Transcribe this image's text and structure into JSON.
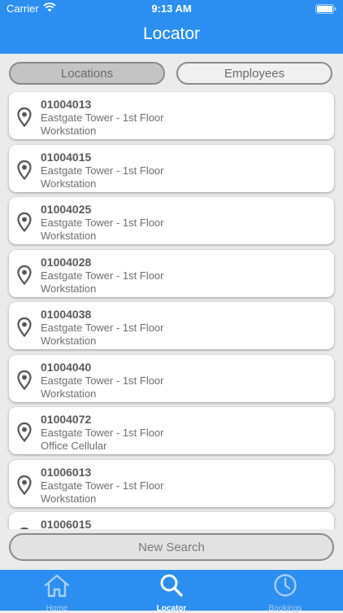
{
  "status_bar": {
    "carrier": "Carrier",
    "time": "9:13 AM"
  },
  "header": {
    "title": "Locator"
  },
  "segments": {
    "locations": "Locations",
    "employees": "Employees",
    "selected": "Locations"
  },
  "locations": [
    {
      "code": "01004013",
      "building": "Eastgate Tower - 1st Floor",
      "type": "Workstation"
    },
    {
      "code": "01004015",
      "building": "Eastgate Tower - 1st Floor",
      "type": "Workstation"
    },
    {
      "code": "01004025",
      "building": "Eastgate Tower - 1st Floor",
      "type": "Workstation"
    },
    {
      "code": "01004028",
      "building": "Eastgate Tower - 1st Floor",
      "type": "Workstation"
    },
    {
      "code": "01004038",
      "building": "Eastgate Tower - 1st Floor",
      "type": "Workstation"
    },
    {
      "code": "01004040",
      "building": "Eastgate Tower - 1st Floor",
      "type": "Workstation"
    },
    {
      "code": "01004072",
      "building": "Eastgate Tower - 1st Floor",
      "type": "Office Cellular"
    },
    {
      "code": "01006013",
      "building": "Eastgate Tower - 1st Floor",
      "type": "Workstation"
    },
    {
      "code": "01006015",
      "building": "",
      "type": ""
    }
  ],
  "new_search_label": "New Search",
  "tabbar": {
    "home": "Home",
    "locator": "Locator",
    "bookings": "Bookings"
  },
  "icons": {
    "wifi": "wifi-icon",
    "battery": "battery-icon",
    "pin": "location-pin-icon",
    "home": "home-icon",
    "search": "search-icon",
    "clock": "clock-icon"
  },
  "colors": {
    "accent": "#2b8ef0",
    "background": "#ebebeb"
  }
}
